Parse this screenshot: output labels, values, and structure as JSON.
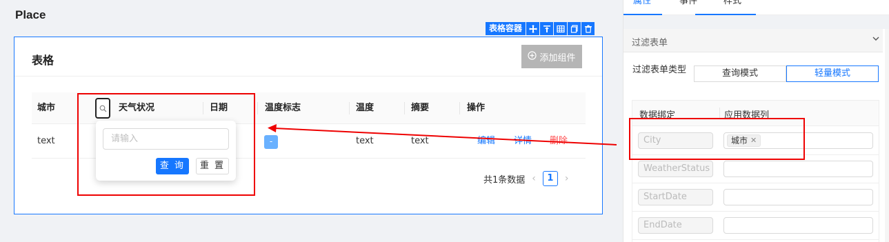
{
  "page": {
    "title": "Place"
  },
  "toolbar": {
    "tag": "表格容器",
    "icons": [
      "move-icon",
      "align-top-icon",
      "table-icon",
      "copy-icon",
      "delete-icon"
    ]
  },
  "card": {
    "title": "表格",
    "add_button": "添加组件"
  },
  "table": {
    "columns": [
      "城市",
      "天气状况",
      "日期",
      "温度标志",
      "温度",
      "摘要",
      "操作"
    ],
    "row": {
      "city": "text",
      "temp_flag": "-",
      "temperature": "text",
      "summary": "text",
      "actions": [
        "编辑",
        "详情",
        "删除"
      ]
    }
  },
  "pagination": {
    "total_text": "共1条数据",
    "current_page": "1"
  },
  "filter_popover": {
    "placeholder": "请输入",
    "query_label": "查 询",
    "reset_label": "重 置"
  },
  "panel": {
    "tabs": [
      "属性",
      "事件",
      "样式"
    ],
    "section_title": "过滤表单",
    "filter_type_label": "过滤表单类型",
    "filter_modes": [
      "查询模式",
      "轻量模式"
    ],
    "active_mode": "轻量模式",
    "binding_headers": [
      "数据绑定",
      "应用数据列"
    ],
    "bindings": [
      {
        "field": "City",
        "column_chip": "城市"
      },
      {
        "field": "WeatherStatus",
        "column_chip": ""
      },
      {
        "field": "StartDate",
        "column_chip": ""
      },
      {
        "field": "EndDate",
        "column_chip": ""
      }
    ]
  },
  "colors": {
    "accent": "#1677ff",
    "danger": "#ff4d4f",
    "annotation": "#e00000"
  }
}
